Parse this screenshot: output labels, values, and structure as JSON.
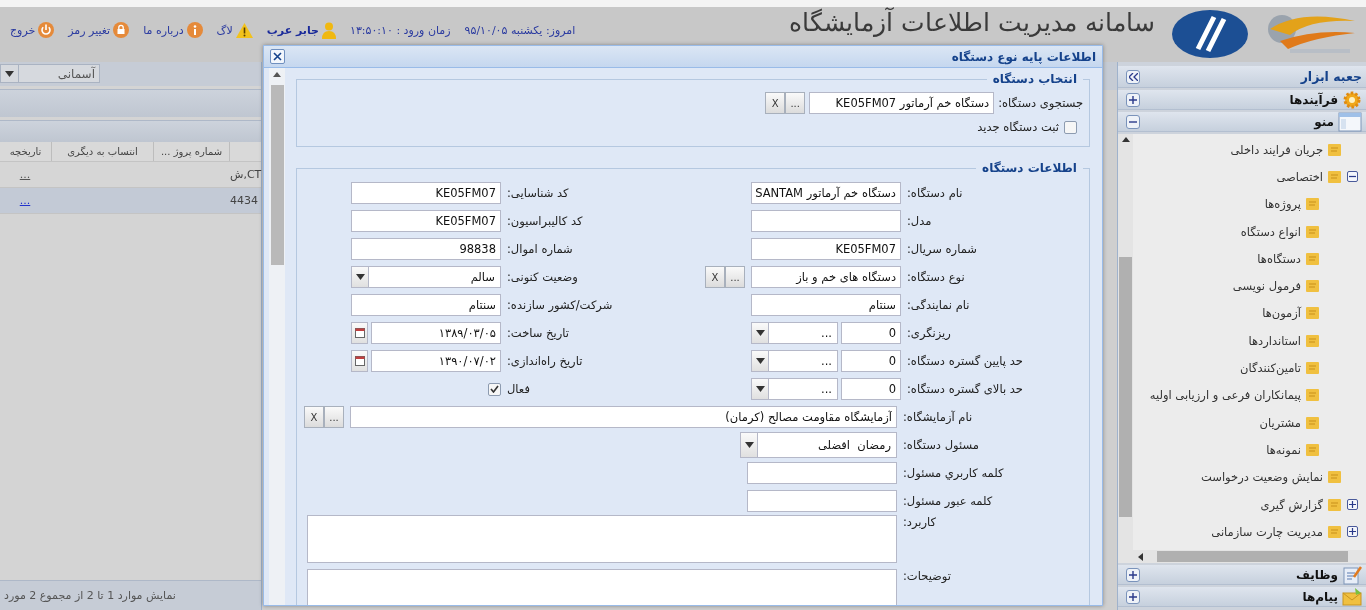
{
  "header": {
    "app_title": "سامانه مدیریت اطلاعات آزمایشگاه",
    "today": "امروز: یکشنبه ۹۵/۱۰/۰۵",
    "login_time": "زمان ورود : ۱۳:۵۰:۱۰",
    "user": "جابر عرب",
    "links": [
      {
        "kind": "log",
        "label": "لاگ"
      },
      {
        "kind": "about",
        "label": "درباره ما"
      },
      {
        "kind": "password",
        "label": "تغییر رمز"
      },
      {
        "kind": "logout",
        "label": "خروج"
      }
    ]
  },
  "left_panel": {
    "theme_select": "آسمانی",
    "columns": [
      "شماره پروژ ...",
      "انتساب به دیگری",
      "تاریخچه"
    ],
    "rows": [
      {
        "column_1": "CT,ش",
        "history": "...",
        "selected": false
      },
      {
        "column_1": "4434",
        "history": "...",
        "selected": true
      }
    ],
    "status": "نمایش موارد 1 تا 2 از مجموع 2 مورد"
  },
  "sidebar": {
    "title": "جعبه ابزار",
    "sections": [
      {
        "kind": "processes",
        "label": "فرآیندها",
        "expanded": false
      },
      {
        "kind": "menu",
        "label": "منو",
        "expanded": true,
        "tree": [
          {
            "label": "جریان فرایند داخلی"
          },
          {
            "label": "اختصاصی",
            "expanded": true,
            "children": [
              {
                "label": "پروژه‌ها"
              },
              {
                "label": "انواع دستگاه"
              },
              {
                "label": "دستگاه‌ها"
              },
              {
                "label": "فرمول نویسی"
              },
              {
                "label": "آزمون‌ها"
              },
              {
                "label": "استانداردها"
              },
              {
                "label": "تامین‌کنندگان"
              },
              {
                "label": "پیمانکاران فرعی و ارزیابی اولیه"
              },
              {
                "label": "مشتریان"
              },
              {
                "label": "نمونه‌ها"
              }
            ]
          },
          {
            "label": "نمایش وضعیت درخواست"
          },
          {
            "label": "گزارش گیری",
            "expanded": false
          },
          {
            "label": "مدیریت چارت سازمانی",
            "expanded": false
          }
        ]
      },
      {
        "kind": "tasks",
        "label": "وظایف",
        "expanded": false
      },
      {
        "kind": "messages",
        "label": "پیام‌ها",
        "expanded": false
      }
    ]
  },
  "dialog": {
    "title": "اطلاعات پایه نوع دستگاه",
    "device_select": {
      "legend": "انتخاب دستگاه",
      "search": {
        "label": "جستجوی دستگاه:",
        "value": "دستگاه خم آرماتور KE05FM07",
        "buttons": [
          "...",
          "X"
        ]
      },
      "new_device": {
        "label": "ثبت دستگاه جدید",
        "checked": false
      }
    },
    "device_info": {
      "legend": "اطلاعات دستگاه",
      "paired_fields": [
        {
          "kind": "text",
          "label": "نام دستگاه:",
          "value": "دستگاه خم آرماتور SANTAM"
        },
        {
          "kind": "text",
          "label": "کد شناسایی:",
          "value": "KE05FM07"
        },
        {
          "kind": "text",
          "label": "مدل:"
        },
        {
          "kind": "text",
          "label": "کد کالیبراسیون:",
          "value": "KE05FM07"
        },
        {
          "kind": "text",
          "label": "شماره سریال:",
          "value": "KE05FM07"
        },
        {
          "kind": "text",
          "label": "شماره اموال:",
          "value": "98838"
        },
        {
          "kind": "lookup",
          "label": "نوع دستگاه:",
          "value": "دستگاه های خم و باز",
          "buttons": [
            "...",
            "X"
          ]
        },
        {
          "kind": "select",
          "label": "وضعیت کنونی:",
          "value": "سالم"
        },
        {
          "kind": "text",
          "label": "نام نمایندگی:",
          "value": "سنتام"
        },
        {
          "kind": "text",
          "label": "شرکت/کشور سازنده:",
          "value": "سنتام"
        },
        {
          "kind": "range",
          "label": "ریزنگری:",
          "value": "0",
          "unit": "..."
        },
        {
          "kind": "date",
          "label": "تاریخ ساخت:",
          "value": "۱۳۸۹/۰۳/۰۵"
        },
        {
          "kind": "range",
          "label": "حد پایین گستره دستگاه:",
          "value": "0",
          "unit": "..."
        },
        {
          "kind": "date",
          "label": "تاریخ راه‌اندازی:",
          "value": "۱۳۹۰/۰۷/۰۲"
        },
        {
          "kind": "range",
          "label": "حد بالای گستره دستگاه:",
          "value": "0",
          "unit": "..."
        },
        {
          "kind": "checkbox",
          "label": "فعال",
          "checked": true
        }
      ],
      "wide_fields": [
        {
          "kind": "lookup",
          "label": "نام آزمایشگاه:",
          "value": "آزمایشگاه مقاومت مصالح (کرمان)",
          "buttons": [
            "...",
            "X"
          ]
        },
        {
          "kind": "select",
          "label": "مسئول دستگاه:",
          "value": "رمضان  افضلی"
        },
        {
          "kind": "text",
          "label": "کلمه کاربري مسئول:"
        },
        {
          "kind": "text",
          "label": "کلمه عبور مسئول:"
        },
        {
          "kind": "textarea",
          "label": "کاربرد:"
        },
        {
          "kind": "textarea",
          "label": "توضیحات:"
        }
      ]
    }
  }
}
